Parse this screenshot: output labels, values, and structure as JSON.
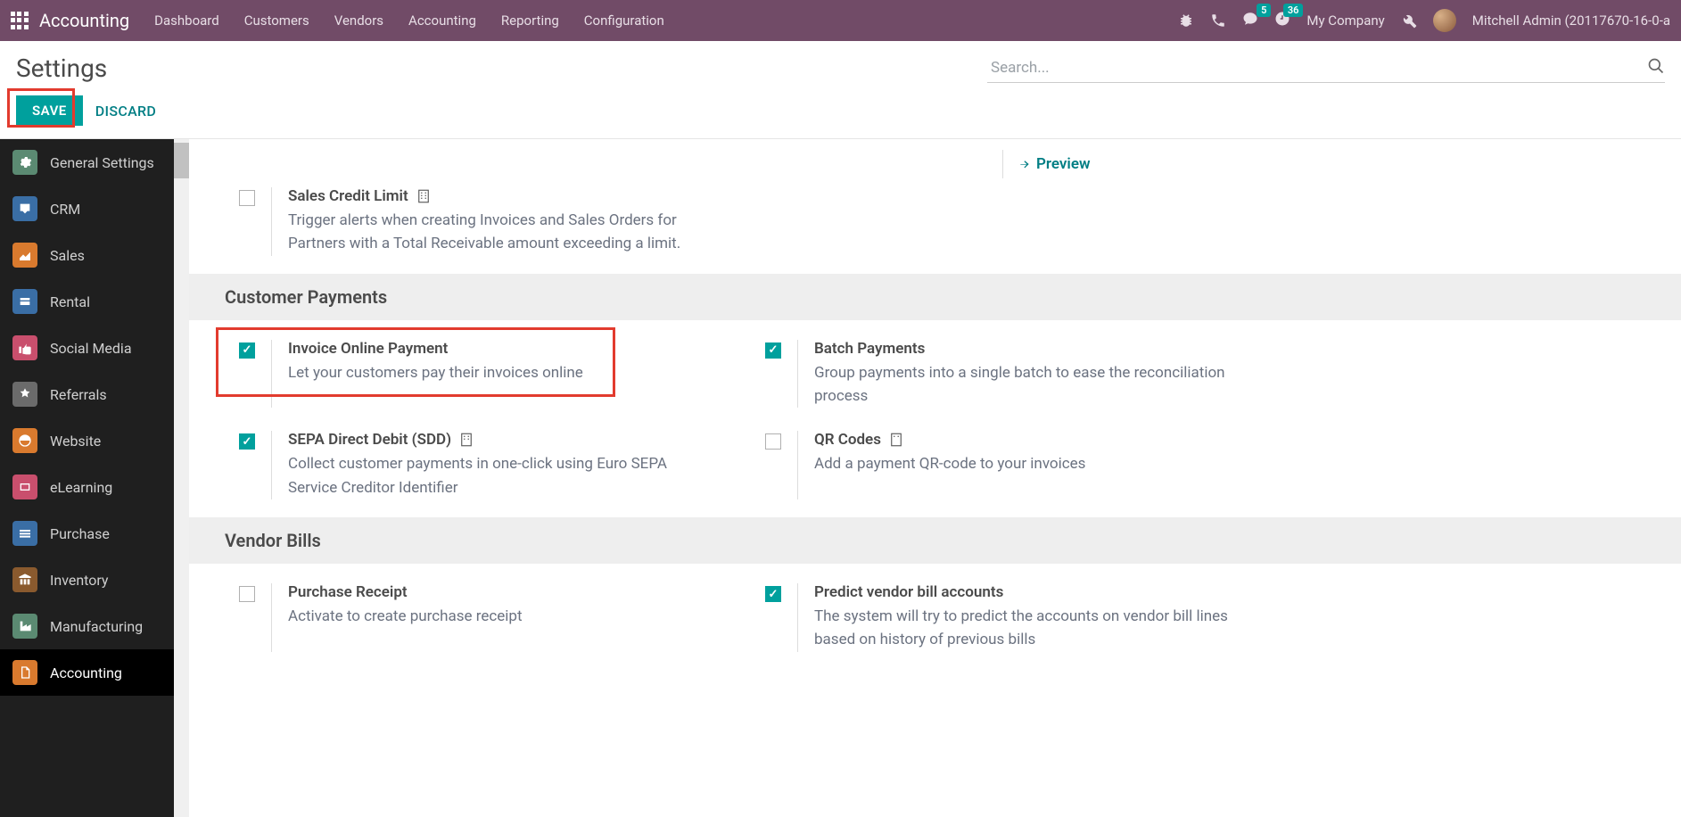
{
  "topnav": {
    "brand": "Accounting",
    "menu": [
      "Dashboard",
      "Customers",
      "Vendors",
      "Accounting",
      "Reporting",
      "Configuration"
    ],
    "msg_count": "5",
    "clock_count": "36",
    "company": "My Company",
    "user": "Mitchell Admin (20117670-16-0-a"
  },
  "header": {
    "title": "Settings",
    "search_placeholder": "Search...",
    "save": "SAVE",
    "discard": "DISCARD"
  },
  "sidebar": [
    {
      "label": "General Settings",
      "color": "#5b8a72"
    },
    {
      "label": "CRM",
      "color": "#3a6ea5"
    },
    {
      "label": "Sales",
      "color": "#d97a2e"
    },
    {
      "label": "Rental",
      "color": "#3a6ea5"
    },
    {
      "label": "Social Media",
      "color": "#c94f6d"
    },
    {
      "label": "Referrals",
      "color": "#6b6b6b"
    },
    {
      "label": "Website",
      "color": "#d97a2e"
    },
    {
      "label": "eLearning",
      "color": "#c94f6d"
    },
    {
      "label": "Purchase",
      "color": "#3a6ea5"
    },
    {
      "label": "Inventory",
      "color": "#8a5a2e"
    },
    {
      "label": "Manufacturing",
      "color": "#5b8a72"
    },
    {
      "label": "Accounting",
      "color": "#d97a2e",
      "active": true
    }
  ],
  "preview": "Preview",
  "settings": {
    "sales_credit_limit": {
      "title": "Sales Credit Limit",
      "desc": "Trigger alerts when creating Invoices and Sales Orders for Partners with a Total Receivable amount exceeding a limit."
    },
    "section_customer_payments": "Customer Payments",
    "invoice_online": {
      "title": "Invoice Online Payment",
      "desc": "Let your customers pay their invoices online"
    },
    "batch_payments": {
      "title": "Batch Payments",
      "desc": "Group payments into a single batch to ease the reconciliation process"
    },
    "sepa": {
      "title": "SEPA Direct Debit (SDD)",
      "desc": "Collect customer payments in one-click using Euro SEPA Service Creditor Identifier"
    },
    "qr": {
      "title": "QR Codes",
      "desc": "Add a payment QR-code to your invoices"
    },
    "section_vendor_bills": "Vendor Bills",
    "purchase_receipt": {
      "title": "Purchase Receipt",
      "desc": "Activate to create purchase receipt"
    },
    "predict": {
      "title": "Predict vendor bill accounts",
      "desc": "The system will try to predict the accounts on vendor bill lines based on history of previous bills"
    }
  }
}
